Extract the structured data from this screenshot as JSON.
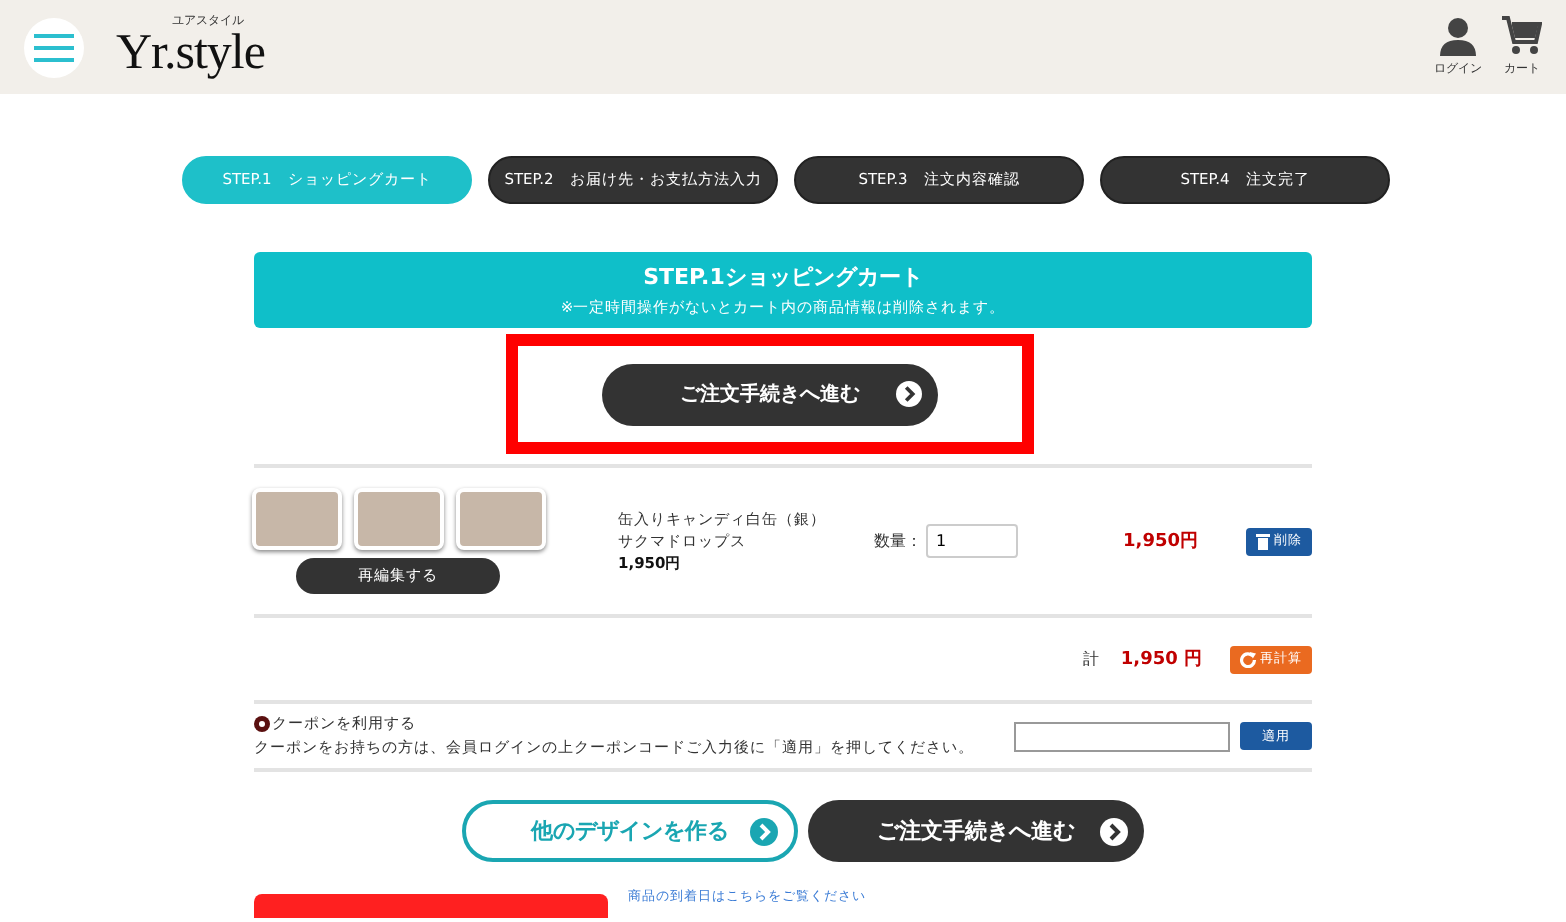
{
  "header": {
    "logo": "Yr.style",
    "logo_reading": "ユアスタイル",
    "actions": [
      {
        "kind": "user",
        "label": "ログイン"
      },
      {
        "kind": "cart",
        "label": "カート"
      }
    ]
  },
  "steps": [
    {
      "label": "STEP.1　ショッピングカート",
      "selected": true
    },
    {
      "label": "STEP.2　お届け先・お支払方法入力",
      "selected": false
    },
    {
      "label": "STEP.3　注文内容確認",
      "selected": false
    },
    {
      "label": "STEP.4　注文完了",
      "selected": false
    }
  ],
  "banner": {
    "title": "STEP.1ショッピングカート",
    "note": "※一定時間操作がないとカート内の商品情報は削除されます。"
  },
  "proceed_top": "ご注文手続きへ進む",
  "item": {
    "name": "缶入りキャンディ白缶（銀）サクマドロップス",
    "unit_price": "1,950円",
    "quantity_label": "数量：",
    "quantity": "1",
    "price": "1,950円",
    "delete": "削除",
    "reedit": "再編集する"
  },
  "total": {
    "label": "計",
    "value": "1,950 円",
    "recalc": "再計算"
  },
  "coupon": {
    "title": "クーポンを利用する",
    "note": "クーポンをお持ちの方は、会員ログインの上クーポンコードご入力後に「適用」を押してください。",
    "apply": "適用"
  },
  "bottom_buttons": [
    {
      "kind": "outline",
      "label": "他のデザインを作る"
    },
    {
      "kind": "dark",
      "label": "ご注文手続きへ進む"
    }
  ],
  "footer_link": "商品の到着日はこちらをご覧ください"
}
